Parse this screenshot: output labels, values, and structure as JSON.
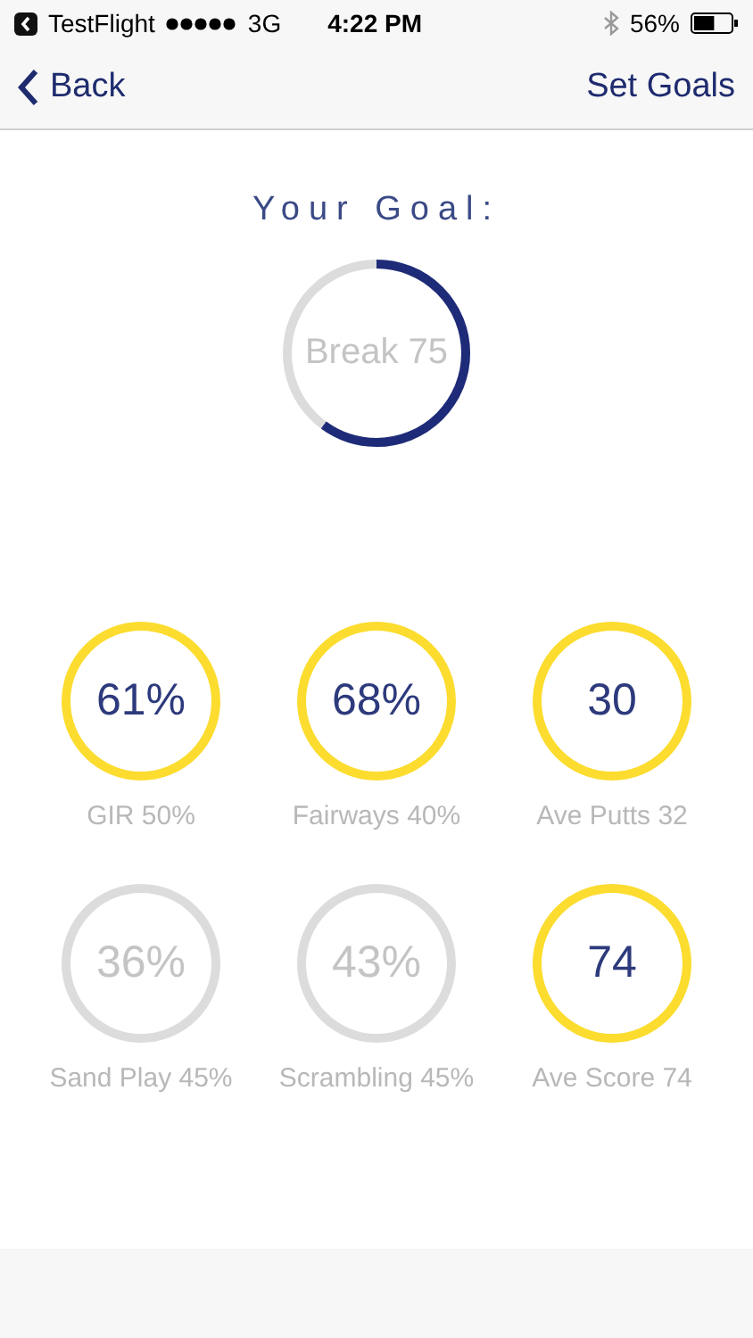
{
  "status_bar": {
    "app": "TestFlight",
    "network": "3G",
    "time": "4:22 PM",
    "battery": "56%"
  },
  "nav": {
    "back": "Back",
    "action": "Set Goals"
  },
  "goal": {
    "title": "Your Goal:",
    "value": "Break 75",
    "level": 0.6
  },
  "stats": [
    {
      "value": "61%",
      "label": "GIR 50%",
      "met": true
    },
    {
      "value": "68%",
      "label": "Fairways 40%",
      "met": true
    },
    {
      "value": "30",
      "label": "Ave Putts 32",
      "met": true
    },
    {
      "value": "36%",
      "label": "Sand Play 45%",
      "met": false
    },
    {
      "value": "43%",
      "label": "Scrambling 45%",
      "met": false
    },
    {
      "value": "74",
      "label": "Ave Score 74",
      "met": true
    }
  ]
}
